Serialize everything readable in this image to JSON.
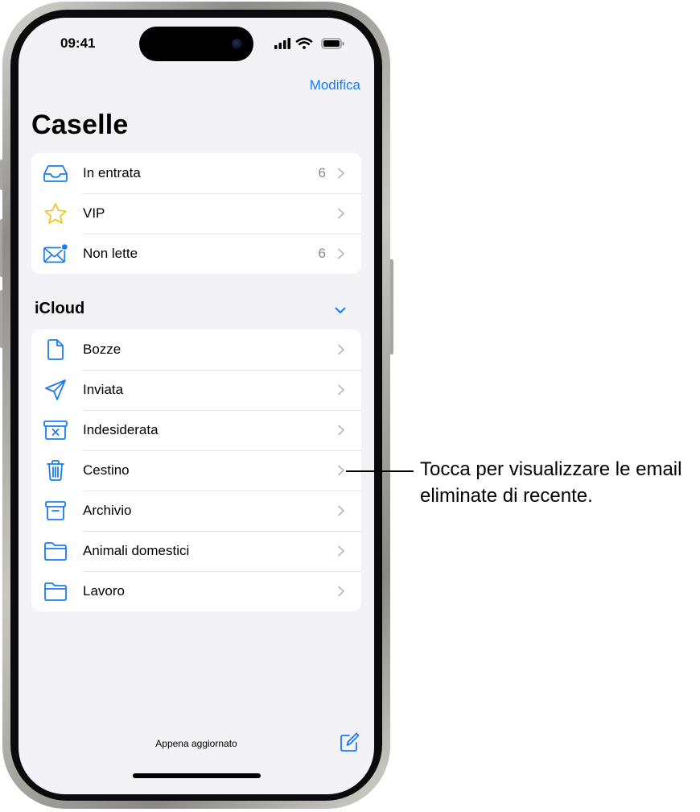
{
  "status_bar": {
    "time": "09:41"
  },
  "header": {
    "edit_label": "Modifica",
    "title": "Caselle"
  },
  "mailboxes": [
    {
      "icon": "inbox-icon",
      "label": "In entrata",
      "count": "6"
    },
    {
      "icon": "star-icon",
      "label": "VIP",
      "count": ""
    },
    {
      "icon": "unread-envelope-icon",
      "label": "Non lette",
      "count": "6"
    }
  ],
  "icloud": {
    "section_title": "iCloud",
    "folders": [
      {
        "icon": "draft-document-icon",
        "label": "Bozze"
      },
      {
        "icon": "paperplane-icon",
        "label": "Inviata"
      },
      {
        "icon": "junk-icon",
        "label": "Indesiderata"
      },
      {
        "icon": "trash-icon",
        "label": "Cestino"
      },
      {
        "icon": "archive-box-icon",
        "label": "Archivio"
      },
      {
        "icon": "folder-icon",
        "label": "Animali domestici"
      },
      {
        "icon": "folder-icon",
        "label": "Lavoro"
      }
    ]
  },
  "footer": {
    "status_text": "Appena aggiornato"
  },
  "callout": {
    "text": "Tocca per visualizzare le email eliminate di recente."
  },
  "colors": {
    "accent": "#1a7cf5",
    "vip_star": "#f3c416",
    "background": "#f2f2f7"
  }
}
